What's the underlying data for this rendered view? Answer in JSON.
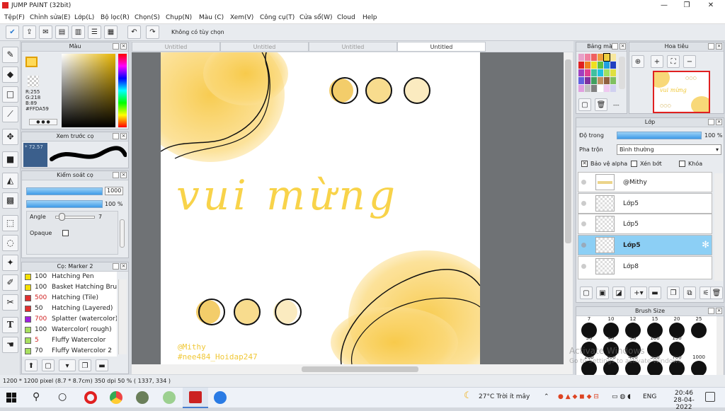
{
  "window": {
    "title": "JUMP PAINT (32bit)"
  },
  "menu": [
    "Tệp(F)",
    "Chỉnh sửa(E)",
    "Lớp(L)",
    "Bộ lọc(R)",
    "Chọn(S)",
    "Chụp(N)",
    "Màu (C)",
    "Xem(V)",
    "Công cụ(T)",
    "Cửa sổ(W)",
    "Cloud",
    "Help"
  ],
  "toolbar": {
    "custom_label": "Không có tùy chọn"
  },
  "color_panel": {
    "title": "Màu",
    "r": "R:255",
    "g": "G:218",
    "b": "B:89",
    "hex": "#FFDA59",
    "primary_color": "#FFDA59"
  },
  "preview_panel": {
    "title": "Xem trước cọ",
    "zoom": "72.57"
  },
  "brush_control": {
    "title": "Kiểm soát cọ",
    "size": "1000",
    "opacity": "100 %",
    "angle_label": "Angle",
    "angle_value": "7",
    "opaque_label": "Opaque"
  },
  "brush_list": {
    "title": "Cọ: Marker 2",
    "items": [
      {
        "size": "100",
        "name": "Hatching Pen",
        "color": "#f5e000",
        "size_color": "#222"
      },
      {
        "size": "100",
        "name": "Basket Hatching Brush",
        "color": "#f5e000",
        "size_color": "#222"
      },
      {
        "size": "500",
        "name": "Hatching (Tile)",
        "color": "#e03030",
        "size_color": "#d02020"
      },
      {
        "size": "50",
        "name": "Hatching (Layered)",
        "color": "#e03030",
        "size_color": "#222"
      },
      {
        "size": "700",
        "name": "Splatter (watercolor)",
        "color": "#a020e0",
        "size_color": "#d02020"
      },
      {
        "size": "100",
        "name": "Watercolor( rough)",
        "color": "#a8e060",
        "size_color": "#222"
      },
      {
        "size": "5",
        "name": "Fluffy Watercolor",
        "color": "#a8e060",
        "size_color": "#d02020"
      },
      {
        "size": "70",
        "name": "Fluffy Watercolor 2",
        "color": "#a8e060",
        "size_color": "#222"
      }
    ]
  },
  "tabs": [
    "Untitled",
    "Untitled",
    "Untitled",
    "Untitled"
  ],
  "canvas": {
    "title_text": "vui mừng",
    "signature_line1": "@Mithy",
    "signature_line2": "#nee484_Hoidap247"
  },
  "swatch_panel": {
    "title": "Bảng màu",
    "more": "---"
  },
  "navigator": {
    "title": "Hoa tiêu"
  },
  "layers": {
    "title": "Lớp",
    "opacity_label": "Độ trong",
    "opacity_value": "100 %",
    "blend_label": "Pha trộn",
    "blend_value": "Bình thường",
    "protect_alpha": "Bảo vệ alpha",
    "clip": "Xén bớt",
    "lock": "Khóa",
    "items": [
      {
        "name": "@Mithy"
      },
      {
        "name": "Lớp5"
      },
      {
        "name": "Lớp5"
      },
      {
        "name": "Lớp5"
      },
      {
        "name": "Lớp8"
      }
    ]
  },
  "brush_size": {
    "title": "Brush Size",
    "row1": [
      "7",
      "10",
      "12",
      "15",
      "20",
      "25"
    ],
    "row2": [
      "30",
      "40",
      "50",
      "100",
      "150"
    ],
    "row3": [
      "200",
      "300",
      "400",
      "500",
      "700",
      "1000"
    ]
  },
  "status": {
    "text": "1200 * 1200 pixel  (8.7 * 8.7cm)  350 dpi  50 %  ( 1337, 334 )"
  },
  "watermark": {
    "line1": "Activate Windows",
    "line2": "Go to Settings to activate Windows."
  },
  "taskbar": {
    "weather": "27°C  Trời ít mây",
    "lang": "ENG",
    "time": "20:46",
    "date": "28-04-2022"
  }
}
